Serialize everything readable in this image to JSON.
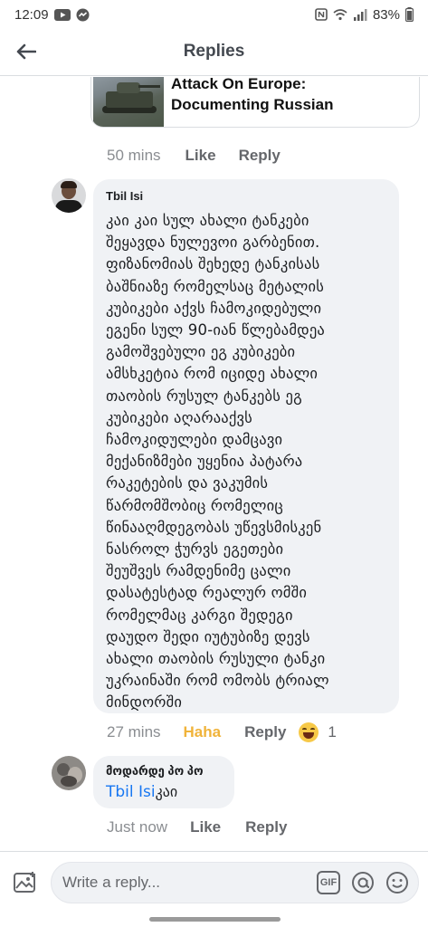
{
  "status_bar": {
    "time": "12:09",
    "battery": "83%"
  },
  "header": {
    "title": "Replies"
  },
  "link_card": {
    "title_line1": "Attack On Europe:",
    "title_line2": "Documenting Russian"
  },
  "meta_1": {
    "time": "50 mins",
    "like": "Like",
    "reply": "Reply"
  },
  "comment_1": {
    "author": "Tbil Isi",
    "text": "კაი კაი სულ ახალი ტანკები\nშეყავდა ნულევოი გარბენით.\nფიზანომიას შეხედე ტანკისას\nბაშნიაზე რომელსაც მეტალის\nკუბიკები აქვს ჩამოკიდებული\nეგენი სულ 90-იან წლებამდეა\nგამოშვებული ეგ კუბიკები\nამსხკეტია რომ იციდე ახალი\nთაობის რუსულ ტანკებს ეგ\nკუბიკები აღარააქვს\nჩამოკიდულები დამცავი\nმექანიზმები უყენია პატარა\nრაკეტების და ვაკუმის\nწარმომშობიც რომელიც\nწინააღმდეგობას უწევსმისკენ\nნასროლ ჭურვს ეგეთები\nშეუშვეს რამდენიმე ცალი\nდასატესტად რეალურ ომში\nრომელმაც კარგი შედეგი\nდაუდო შედი იუტუბიზე დევს\nახალი თაობის რუსული ტანკი\nუკრაინაში რომ ომობს ტრიალ\nმინდორში"
  },
  "meta_2": {
    "time": "27 mins",
    "reaction": "Haha",
    "reply": "Reply",
    "reaction_count": "1"
  },
  "comment_2": {
    "author": "მოდარდე პო პო",
    "mention": "Tbil Isi",
    "text": "კაი"
  },
  "meta_3": {
    "time": "Just now",
    "like": "Like",
    "reply": "Reply"
  },
  "composer": {
    "placeholder": "Write a reply...",
    "gif_label": "GIF"
  },
  "colors": {
    "accent": "#1877f2",
    "bubble": "#f0f2f5",
    "haha": "#f0b33a"
  }
}
